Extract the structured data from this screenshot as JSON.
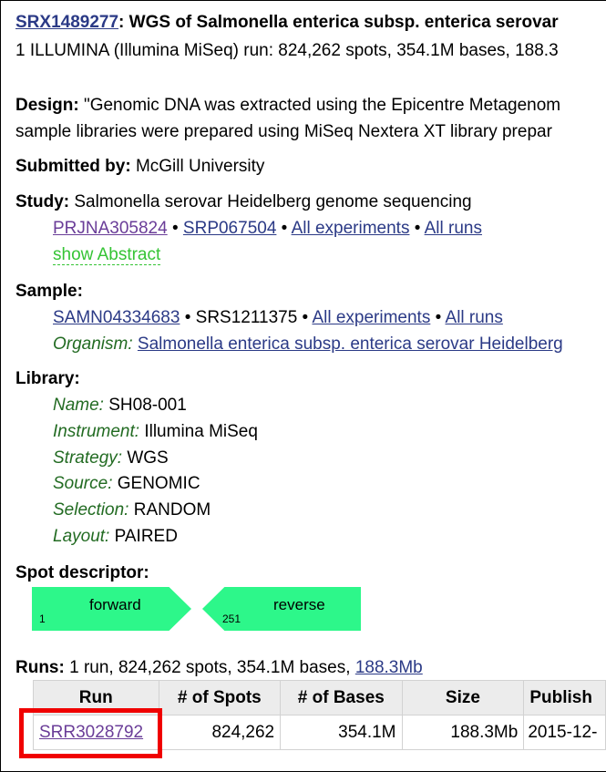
{
  "header": {
    "accession": "SRX1489277",
    "title_rest": ": WGS of Salmonella enterica subsp. enterica serovar",
    "run_summary": "1 ILLUMINA (Illumina MiSeq) run: 824,262 spots, 354.1M bases, 188.3"
  },
  "design": {
    "label": "Design:",
    "line1": " \"Genomic DNA was extracted using the Epicentre Metagenom",
    "line2": "sample libraries were prepared using MiSeq Nextera XT library prepar"
  },
  "submitted": {
    "label": "Submitted by:",
    "value": " McGill University"
  },
  "study": {
    "label": "Study:",
    "value": " Salmonella serovar Heidelberg genome sequencing",
    "bioproject": "PRJNA305824",
    "srp": "SRP067504",
    "all_experiments": "All experiments",
    "all_runs": "All runs",
    "separator": " • ",
    "show_abstract": "show Abstract"
  },
  "sample": {
    "label": "Sample:",
    "biosample": "SAMN04334683",
    "srs": "SRS1211375",
    "all_experiments": "All experiments",
    "all_runs": "All runs",
    "separator": " • ",
    "organism_label": "Organism:",
    "organism": "Salmonella enterica subsp. enterica serovar Heidelberg"
  },
  "library": {
    "label": "Library:",
    "fields": [
      {
        "key": "Name:",
        "value": " SH08-001"
      },
      {
        "key": "Instrument:",
        "value": " Illumina MiSeq"
      },
      {
        "key": "Strategy:",
        "value": " WGS"
      },
      {
        "key": "Source:",
        "value": " GENOMIC"
      },
      {
        "key": "Selection:",
        "value": " RANDOM"
      },
      {
        "key": "Layout:",
        "value": " PAIRED"
      }
    ]
  },
  "spot_descriptor": {
    "label": "Spot descriptor:",
    "forward_label": "forward",
    "forward_pos": "1",
    "reverse_label": "reverse",
    "reverse_pos": "251",
    "color": "#2df78a"
  },
  "runs": {
    "label": "Runs:",
    "summary": " 1 run, 824,262 spots, 354.1M bases, ",
    "size_link": "188.3Mb",
    "columns": [
      "Run",
      "# of Spots",
      "# of Bases",
      "Size",
      "Publish"
    ],
    "rows": [
      [
        "SRR3028792",
        "824,262",
        "354.1M",
        "188.3Mb",
        "2015-12-"
      ]
    ]
  },
  "colors": {
    "link": "#2b3a86",
    "visited_link": "#6a3d98",
    "field_label_green": "#226b22",
    "toggle_green": "#35c435",
    "highlight_red": "#f00000",
    "table_header_bg": "#ececec"
  }
}
